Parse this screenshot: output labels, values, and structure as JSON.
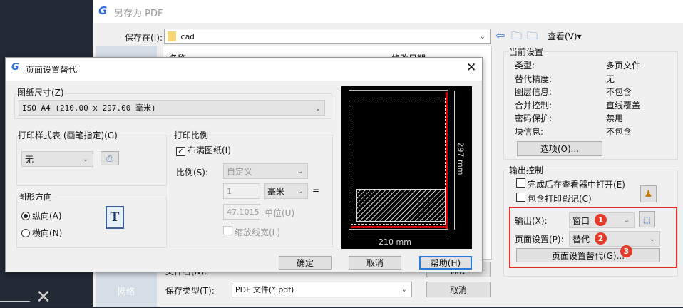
{
  "save_dialog": {
    "title": "另存为 PDF",
    "save_in_label": "保存在(I):",
    "save_in_value": "cad",
    "view_label": "查看(V)",
    "col_name": "名称",
    "col_date": "修改日期",
    "sidebar_network": "网络",
    "filename_label": "文件名(N):",
    "filetype_label": "保存类型(T):",
    "filetype_value": "PDF 文件(*.pdf)",
    "save_button": "保存",
    "cancel_button": "取消",
    "current_settings": {
      "title": "当前设置",
      "rows": [
        {
          "label": "类型:",
          "value": "多页文件"
        },
        {
          "label": "替代精度:",
          "value": "无"
        },
        {
          "label": "图层信息:",
          "value": "不包含"
        },
        {
          "label": "合并控制:",
          "value": "直线覆盖"
        },
        {
          "label": "密码保护:",
          "value": "禁用"
        },
        {
          "label": "块信息:",
          "value": "不包含"
        }
      ],
      "options_button": "选项(O)..."
    },
    "output_control": {
      "title": "输出控制",
      "open_in_viewer": "完成后在查看器中打开(E)",
      "include_stamp": "包含打印戳记(C)",
      "output_label": "输出(X):",
      "output_value": "窗口",
      "page_setup_label": "页面设置(P):",
      "page_setup_value": "替代",
      "page_setup_override_button": "页面设置替代(G)...",
      "badges": [
        "1",
        "2",
        "3"
      ],
      "highlight_color": "#e03030"
    }
  },
  "page_setup_dialog": {
    "title": "页面设置替代",
    "paper_size_label": "图纸尺寸(Z)",
    "paper_size_value": "ISO A4 (210.00 x 297.00 毫米)",
    "plot_style_label": "打印样式表 (画笔指定)(G)",
    "plot_style_value": "无",
    "orientation_label": "图形方向",
    "portrait": "纵向(A)",
    "landscape": "横向(N)",
    "orientation_icon_letter": "T",
    "scale_group_label": "打印比例",
    "fit_to_paper": "布满图纸(I)",
    "scale_label": "比例(S):",
    "scale_value": "自定义",
    "scale_num": "1",
    "unit_value": "毫米",
    "equals": "=",
    "scale_units": "47.1015",
    "units_label": "单位(U)",
    "scale_lineweights": "缩放线宽(L)",
    "preview_width": "210 mm",
    "preview_height": "297 mm",
    "ok_button": "确定",
    "cancel_button": "取消",
    "help_button": "帮助(H)"
  }
}
